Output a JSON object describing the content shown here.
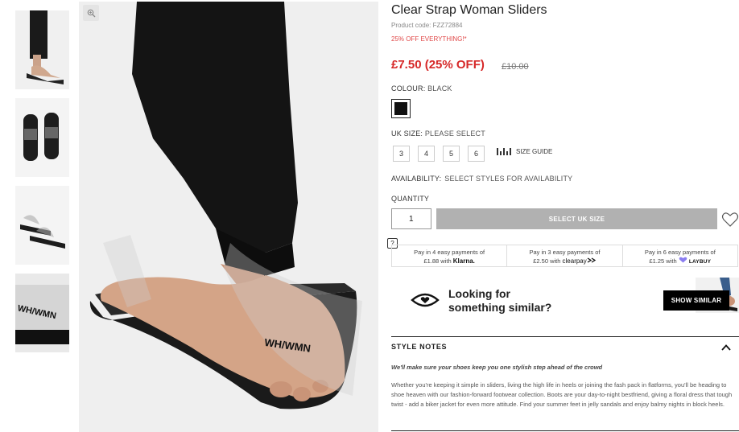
{
  "product": {
    "title": "Clear Strap Woman Sliders",
    "code": "Product code: FZZ72884",
    "promo": "25% OFF EVERYTHING!*",
    "price": "£7.50 (25% OFF)",
    "old_price": "£10.00"
  },
  "colour": {
    "label": "COLOUR:",
    "value": "BLACK",
    "swatch_color": "#111111"
  },
  "size": {
    "label": "UK SIZE:",
    "value": "PLEASE SELECT",
    "options": [
      "3",
      "4",
      "5",
      "6"
    ],
    "guide_label": "SIZE GUIDE"
  },
  "availability": {
    "label": "AVAILABILITY:",
    "value": "SELECT STYLES FOR AVAILABILITY"
  },
  "quantity": {
    "label": "QUANTITY",
    "value": "1"
  },
  "add_button_label": "SELECT UK SIZE",
  "help_label": "?",
  "payments": [
    {
      "line1": "Pay in 4 easy payments of",
      "amount": "£1.88 with",
      "brand": "Klarna."
    },
    {
      "line1": "Pay in 3 easy payments of",
      "amount": "£2.50 with",
      "brand": "clearpay"
    },
    {
      "line1": "Pay in 6 easy payments of",
      "amount": "£1.25 with",
      "brand": "LAYBUY"
    }
  ],
  "similar": {
    "line1": "Looking for",
    "line2": "something similar?",
    "button": "SHOW SIMILAR"
  },
  "notes": {
    "title": "STYLE NOTES",
    "lead": "We'll make sure your shoes keep you one stylish step ahead of the crowd",
    "body": "Whether you're keeping it simple in sliders, living the high life in heels or joining the fash pack in flatforms, you'll be heading to shoe heaven with our fashion-forward footwear collection. Boots are your day-to-night bestfriend, giving a floral dress that tough twist - add a biker jacket for even more attitude. Find your summer feet in jelly sandals and enjoy balmy nights in block heels."
  },
  "image_text": {
    "strap_print": "WH/WMN"
  },
  "icons": [
    "zoom-icon",
    "ruler-icon",
    "heart-icon",
    "eye-icon",
    "chevron-up-icon",
    "help-icon"
  ],
  "colors": {
    "price_red": "#d62828",
    "disabled_button": "#b1b1b1",
    "black": "#000000"
  }
}
